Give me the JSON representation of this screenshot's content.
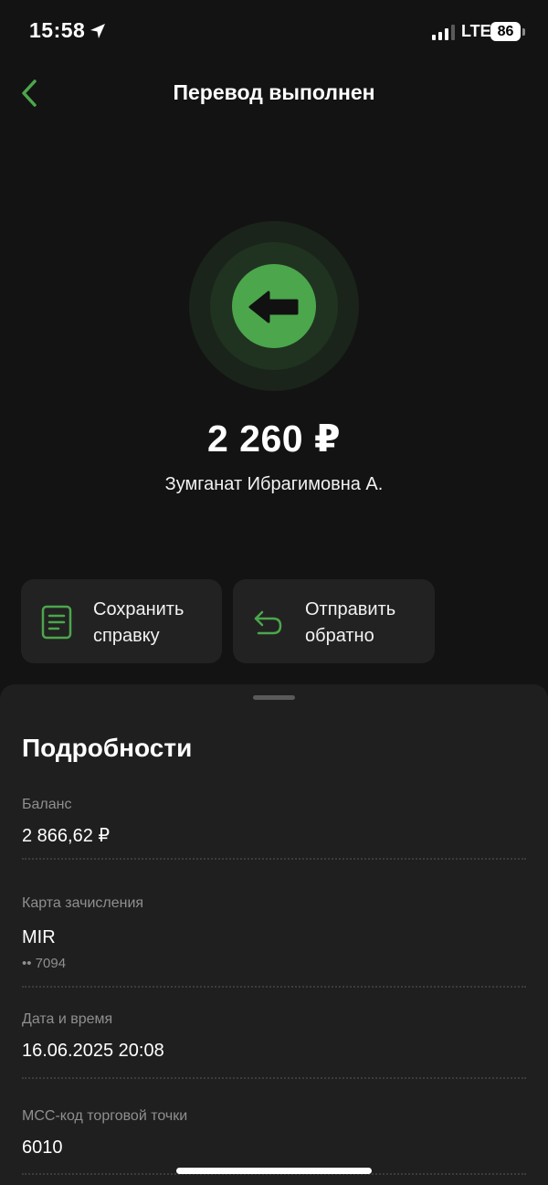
{
  "status_bar": {
    "time": "15:58",
    "network": "LTE",
    "battery": "86",
    "icons": [
      "location-arrow-icon",
      "signal-bars-icon"
    ]
  },
  "header": {
    "title": "Перевод выполнен",
    "back_icon": "chevron-left-icon"
  },
  "transfer": {
    "icon": "incoming-arrow-icon",
    "amount": "2 260 ₽",
    "recipient": "Зумганат Ибрагимовна А."
  },
  "actions": {
    "save": {
      "label": "Сохранить\nсправку",
      "icon": "document-icon"
    },
    "return": {
      "label": "Отправить\nобратно",
      "icon": "return-arrow-icon"
    }
  },
  "details": {
    "title": "Подробности",
    "balance": {
      "label": "Баланс",
      "value": "2 866,62 ₽"
    },
    "card": {
      "label": "Карта зачисления",
      "value": "MIR",
      "number": "•• 7094"
    },
    "datetime": {
      "label": "Дата и время",
      "value": "16.06.2025 20:08"
    },
    "mcc": {
      "label": "MCC-код торговой точки",
      "value": "6010"
    }
  },
  "colors": {
    "background": "#131313",
    "accent": "#4ca64c",
    "card": "#222222",
    "sheet": "#1f1f1f",
    "muted_text": "#8f8f8f"
  }
}
